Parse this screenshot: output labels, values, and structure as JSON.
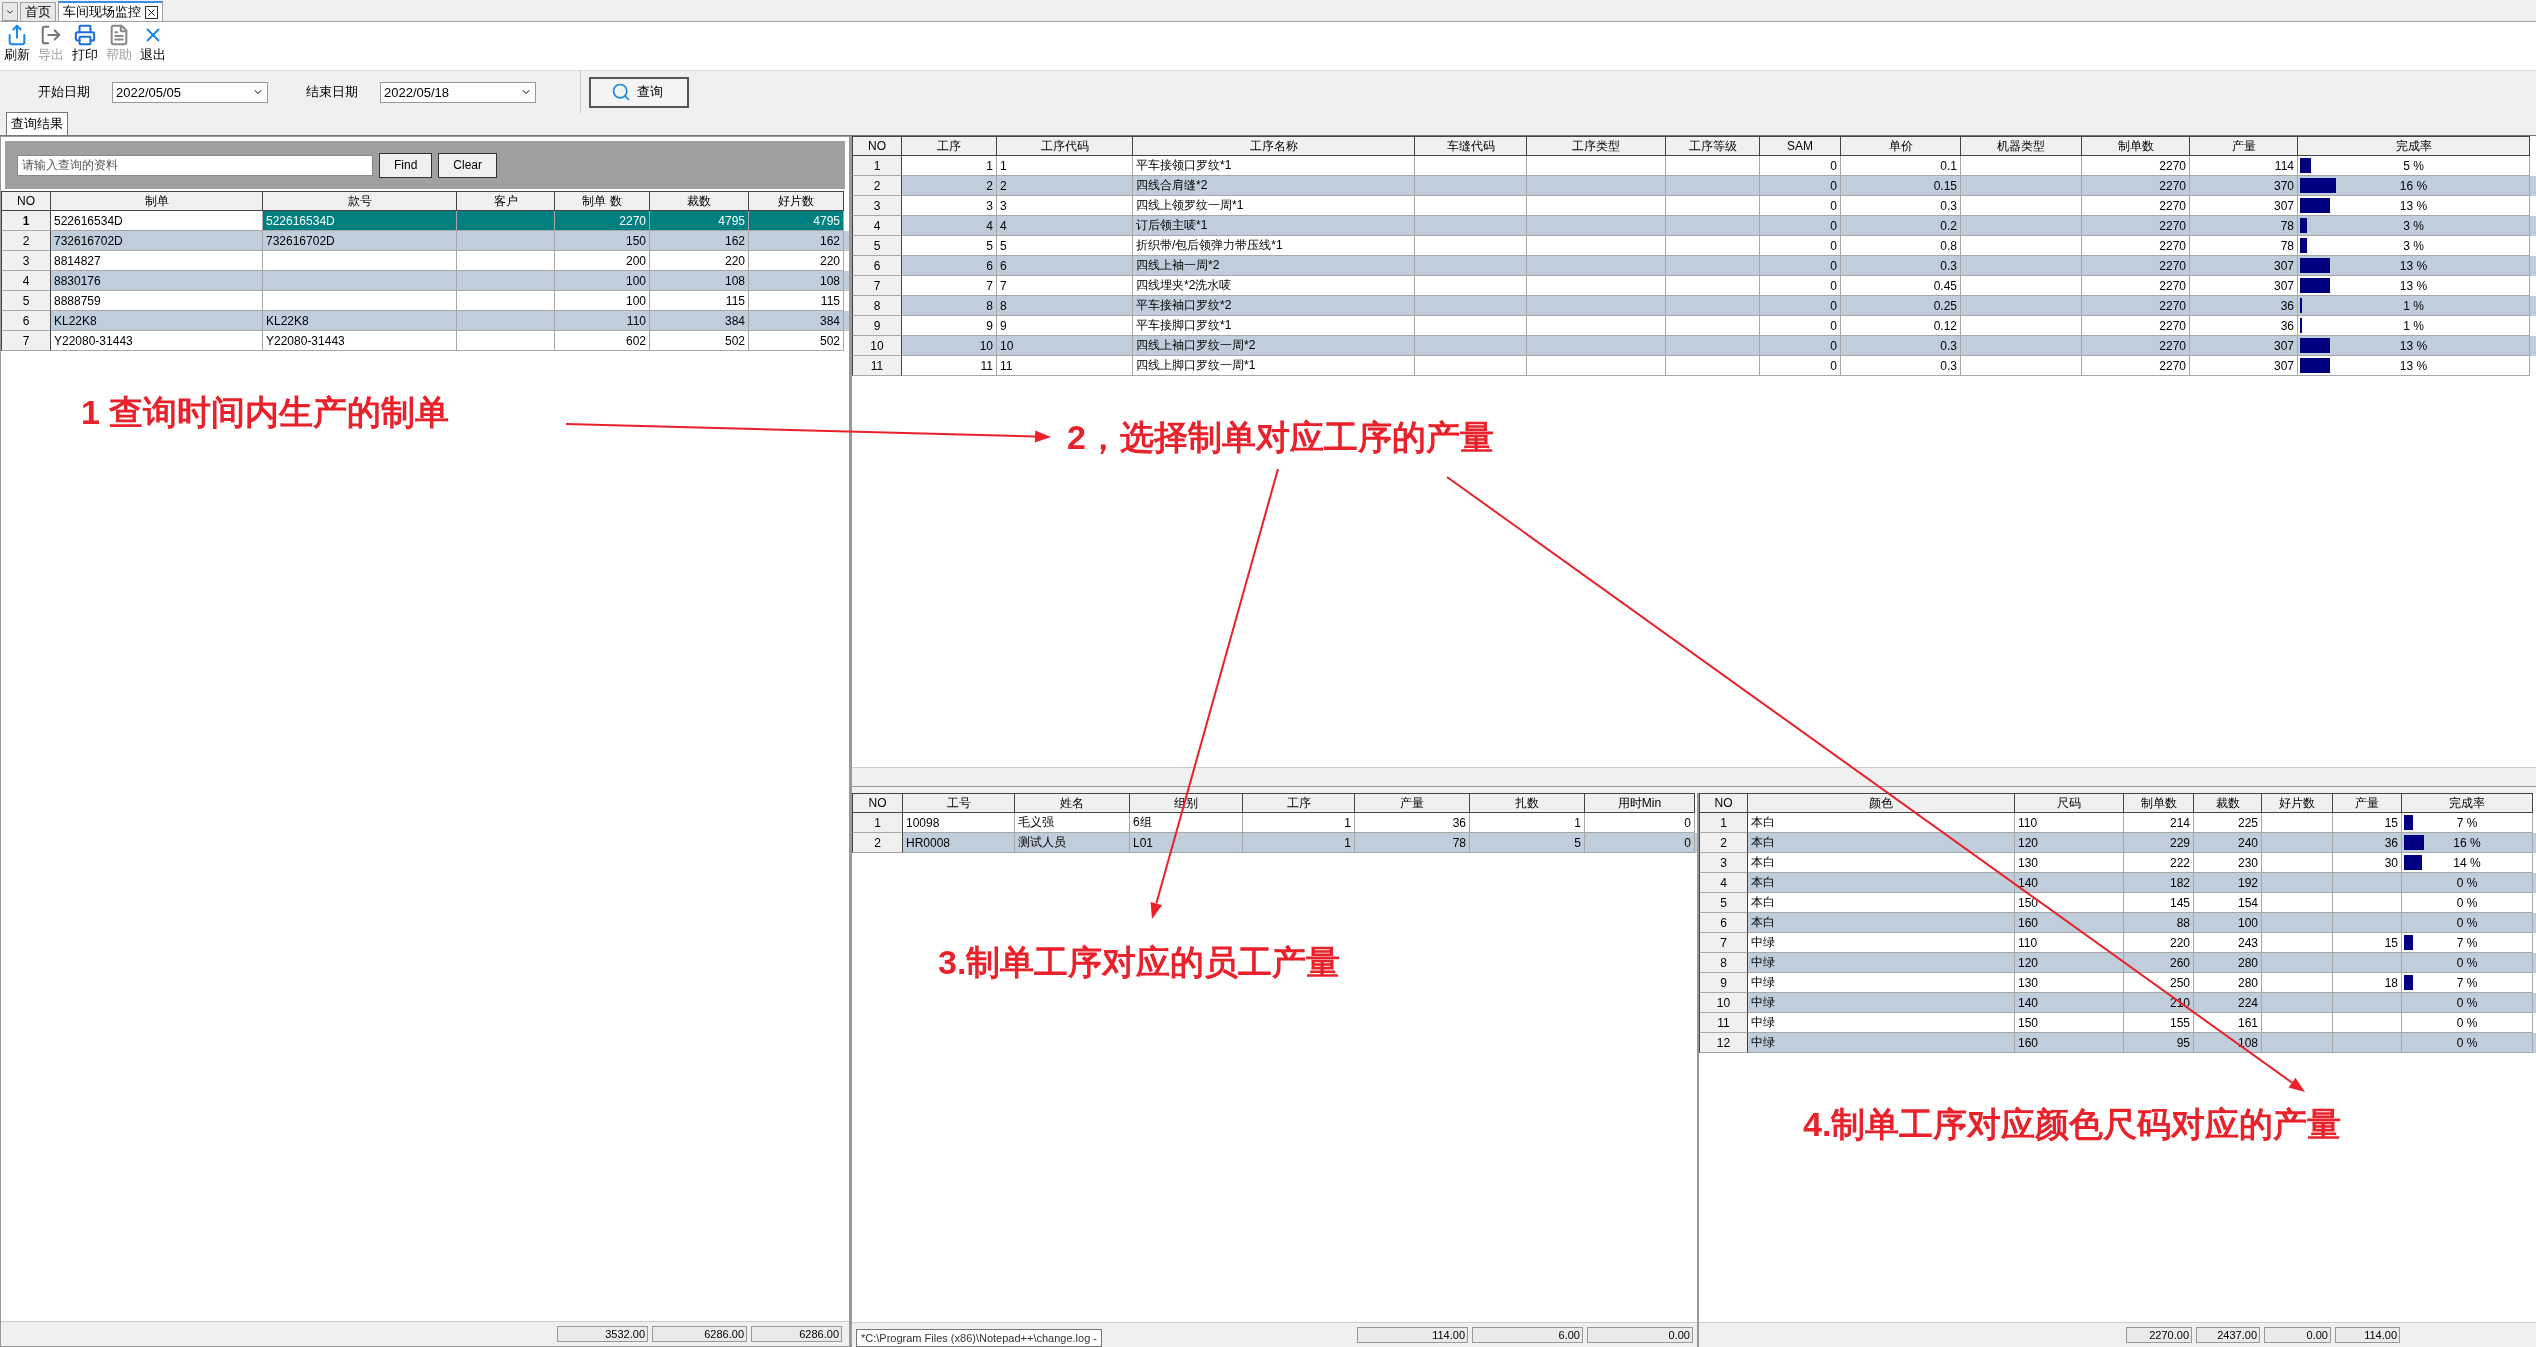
{
  "tabs": [
    {
      "label": "首页",
      "selected": false,
      "closable": false
    },
    {
      "label": "车间现场监控",
      "selected": true,
      "closable": true
    }
  ],
  "toolbar": [
    {
      "label": "刷新",
      "disabled": false
    },
    {
      "label": "导出",
      "disabled": true
    },
    {
      "label": "打印",
      "disabled": false
    },
    {
      "label": "帮助",
      "disabled": true
    },
    {
      "label": "退出",
      "disabled": false
    }
  ],
  "filter": {
    "start_label": "开始日期",
    "start_value": "2022/05/05",
    "end_label": "结束日期",
    "end_value": "2022/05/18",
    "query_button": "查询"
  },
  "result_tab": "查询结果",
  "search": {
    "placeholder": "请输入查询的资料",
    "find": "Find",
    "clear": "Clear"
  },
  "order_table": {
    "columns": [
      "NO",
      "制单",
      "款号",
      "客户",
      "制单 数",
      "裁数",
      "好片数"
    ],
    "rows": [
      {
        "selected": true,
        "cells": [
          "1",
          "522616534D",
          "522616534D",
          null,
          "2270",
          "4795",
          "4795"
        ]
      },
      {
        "selected": false,
        "cells": [
          "2",
          "732616702D",
          "732616702D",
          null,
          "150",
          "162",
          "162"
        ]
      },
      {
        "selected": false,
        "cells": [
          "3",
          "8814827",
          null,
          null,
          "200",
          "220",
          "220"
        ]
      },
      {
        "selected": false,
        "cells": [
          "4",
          "8830176",
          null,
          null,
          "100",
          "108",
          "108"
        ]
      },
      {
        "selected": false,
        "cells": [
          "5",
          "8888759",
          null,
          null,
          "100",
          "115",
          "115"
        ]
      },
      {
        "selected": false,
        "cells": [
          "6",
          "KL22K8",
          "KL22K8",
          null,
          "110",
          "384",
          "384"
        ]
      },
      {
        "selected": false,
        "cells": [
          "7",
          "Y22080-31443",
          "Y22080-31443",
          null,
          "602",
          "502",
          "502"
        ]
      }
    ],
    "totals": [
      "3532.00",
      "6286.00",
      "6286.00"
    ]
  },
  "process_table": {
    "columns": [
      "NO",
      "工序",
      "工序代码",
      "工序名称",
      "车缝代码",
      "工序类型",
      "工序等级",
      "SAM",
      "单价",
      "机器类型",
      "制单数",
      "产量",
      "完成率"
    ],
    "rows": [
      [
        "1",
        "1",
        "1",
        "平车接领口罗纹*1",
        null,
        null,
        null,
        "0",
        "0.1",
        null,
        "2270",
        "114",
        {
          "level": 0.05,
          "text": "5 %"
        }
      ],
      [
        "2",
        "2",
        "2",
        "四线合肩缝*2",
        null,
        null,
        null,
        "0",
        "0.15",
        null,
        "2270",
        "370",
        {
          "level": 0.16,
          "text": "16 %"
        }
      ],
      [
        "3",
        "3",
        "3",
        "四线上领罗纹一周*1",
        null,
        null,
        null,
        "0",
        "0.3",
        null,
        "2270",
        "307",
        {
          "level": 0.13,
          "text": "13 %"
        }
      ],
      [
        "4",
        "4",
        "4",
        "订后领主唛*1",
        null,
        null,
        null,
        "0",
        "0.2",
        null,
        "2270",
        "78",
        {
          "level": 0.03,
          "text": "3 %"
        }
      ],
      [
        "5",
        "5",
        "5",
        "折织带/包后领弹力带压线*1",
        null,
        null,
        null,
        "0",
        "0.8",
        null,
        "2270",
        "78",
        {
          "level": 0.03,
          "text": "3 %"
        }
      ],
      [
        "6",
        "6",
        "6",
        "四线上袖一周*2",
        null,
        null,
        null,
        "0",
        "0.3",
        null,
        "2270",
        "307",
        {
          "level": 0.13,
          "text": "13 %"
        }
      ],
      [
        "7",
        "7",
        "7",
        "四线埋夹*2洗水唛",
        null,
        null,
        null,
        "0",
        "0.45",
        null,
        "2270",
        "307",
        {
          "level": 0.13,
          "text": "13 %"
        }
      ],
      [
        "8",
        "8",
        "8",
        "平车接袖口罗纹*2",
        null,
        null,
        null,
        "0",
        "0.25",
        null,
        "2270",
        "36",
        {
          "level": 0.01,
          "text": "1 %"
        }
      ],
      [
        "9",
        "9",
        "9",
        "平车接脚口罗纹*1",
        null,
        null,
        null,
        "0",
        "0.12",
        null,
        "2270",
        "36",
        {
          "level": 0.01,
          "text": "1 %"
        }
      ],
      [
        "10",
        "10",
        "10",
        "四线上袖口罗纹一周*2",
        null,
        null,
        null,
        "0",
        "0.3",
        null,
        "2270",
        "307",
        {
          "level": 0.13,
          "text": "13 %"
        }
      ],
      [
        "11",
        "11",
        "11",
        "四线上脚口罗纹一周*1",
        null,
        null,
        null,
        "0",
        "0.3",
        null,
        "2270",
        "307",
        {
          "level": 0.13,
          "text": "13 %"
        }
      ]
    ]
  },
  "worker_table": {
    "columns": [
      "NO",
      "工号",
      "姓名",
      "组别",
      "工序",
      "产量",
      "扎数",
      "用时Min"
    ],
    "rows": [
      [
        "1",
        "10098",
        "毛义强",
        "6组",
        "1",
        "36",
        "1",
        "0"
      ],
      [
        "2",
        "HR0008",
        "测试人员",
        "L01",
        "1",
        "78",
        "5",
        "0"
      ]
    ],
    "totals": [
      "114.00",
      "6.00",
      "0.00"
    ]
  },
  "color_table": {
    "columns": [
      "NO",
      "颜色",
      "尺码",
      "制单数",
      "裁数",
      "好片数",
      "产量",
      "完成率"
    ],
    "rows": [
      [
        "1",
        "本白",
        "110",
        "214",
        "225",
        null,
        "15",
        {
          "level": 0.07,
          "text": "7 %"
        }
      ],
      [
        "2",
        "本白",
        "120",
        "229",
        "240",
        null,
        "36",
        {
          "level": 0.16,
          "text": "16 %"
        }
      ],
      [
        "3",
        "本白",
        "130",
        "222",
        "230",
        null,
        "30",
        {
          "level": 0.14,
          "text": "14 %"
        }
      ],
      [
        "4",
        "本白",
        "140",
        "182",
        "192",
        null,
        null,
        {
          "text": "0 %"
        }
      ],
      [
        "5",
        "本白",
        "150",
        "145",
        "154",
        null,
        null,
        {
          "text": "0 %"
        }
      ],
      [
        "6",
        "本白",
        "160",
        "88",
        "100",
        null,
        null,
        {
          "text": "0 %"
        }
      ],
      [
        "7",
        "中绿",
        "110",
        "220",
        "243",
        null,
        "15",
        {
          "level": 0.07,
          "text": "7 %"
        }
      ],
      [
        "8",
        "中绿",
        "120",
        "260",
        "280",
        null,
        null,
        {
          "text": "0 %"
        }
      ],
      [
        "9",
        "中绿",
        "130",
        "250",
        "280",
        null,
        "18",
        {
          "level": 0.07,
          "text": "7 %"
        }
      ],
      [
        "10",
        "中绿",
        "140",
        "210",
        "224",
        null,
        null,
        {
          "text": "0 %"
        }
      ],
      [
        "11",
        "中绿",
        "150",
        "155",
        "161",
        null,
        null,
        {
          "text": "0 %"
        }
      ],
      [
        "12",
        "中绿",
        "160",
        "95",
        "108",
        null,
        null,
        {
          "text": "0 %"
        }
      ]
    ],
    "totals": [
      "2270.00",
      "2437.00",
      "0.00",
      "114.00"
    ]
  },
  "annotations": [
    "1 查询时间内生产的制单",
    "2，选择制单对应工序的产量",
    "3.制单工序对应的员工产量",
    "4.制单工序对应颜色尺码对应的产量"
  ],
  "tooltip": "*C:\\Program Files (x86)\\Notepad++\\change.log -"
}
